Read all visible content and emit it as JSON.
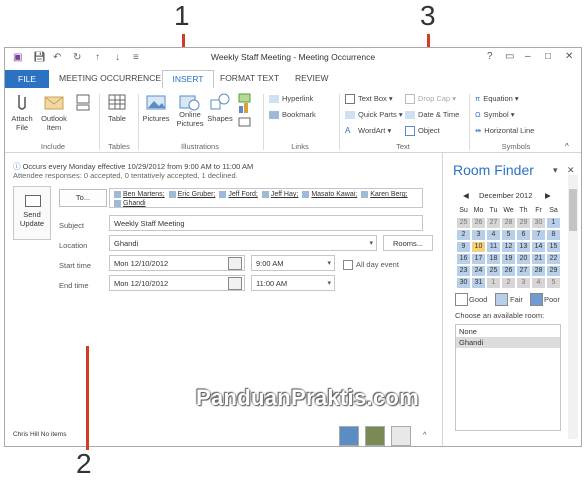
{
  "callouts": [
    "1",
    "3",
    "2"
  ],
  "window": {
    "title": "Weekly Staff Meeting - Meeting Occurrence",
    "controls": [
      "?",
      "▭",
      "–",
      "□",
      "✕"
    ]
  },
  "tabs": {
    "file": "FILE",
    "items": [
      "MEETING OCCURRENCE",
      "INSERT",
      "FORMAT TEXT",
      "REVIEW"
    ],
    "active": "INSERT"
  },
  "ribbon": {
    "include": {
      "attach_file": "Attach File",
      "outlook_item": "Outlook Item",
      "group": "Include"
    },
    "tables": {
      "table": "Table",
      "group": "Tables"
    },
    "illustrations": {
      "pictures": "Pictures",
      "online_pictures": "Online Pictures",
      "shapes": "Shapes",
      "group": "Illustrations"
    },
    "links": {
      "hyperlink": "Hyperlink",
      "bookmark": "Bookmark",
      "group": "Links"
    },
    "text": {
      "text_box": "Text Box",
      "quick_parts": "Quick Parts",
      "wordart": "WordArt",
      "drop_cap": "Drop Cap",
      "date_time": "Date & Time",
      "object": "Object",
      "group": "Text"
    },
    "symbols": {
      "equation": "Equation",
      "symbol": "Symbol",
      "horizontal_line": "Horizontal Line",
      "group": "Symbols"
    }
  },
  "info": {
    "line1": "Occurs every Monday effective 10/29/2012 from 9:00 AM to 11:00 AM",
    "line2": "Attendee responses: 0 accepted, 0 tentatively accepted, 1 declined."
  },
  "form": {
    "send_update": "Send Update",
    "to_button": "To...",
    "attendees": [
      "Ben Martens;",
      "Eric Gruber;",
      "Jeff Ford;",
      "Jeff Hay;",
      "Masato Kawai;",
      "Karen Berg;",
      "Ghandi"
    ],
    "subject_label": "Subject",
    "subject_value": "Weekly Staff Meeting",
    "location_label": "Location",
    "location_value": "Ghandi",
    "rooms_button": "Rooms...",
    "start_label": "Start time",
    "start_date": "Mon 12/10/2012",
    "start_time": "9:00 AM",
    "all_day": "All day event",
    "end_label": "End time",
    "end_date": "Mon 12/10/2012",
    "end_time": "11:00 AM"
  },
  "status": {
    "name": "Chris Hill  No items"
  },
  "room_finder": {
    "title": "Room Finder",
    "month": "December 2012",
    "days": [
      "Su",
      "Mo",
      "Tu",
      "We",
      "Th",
      "Fr",
      "Sa"
    ],
    "weeks": [
      [
        "25",
        "26",
        "27",
        "28",
        "29",
        "30",
        "1"
      ],
      [
        "2",
        "3",
        "4",
        "5",
        "6",
        "7",
        "8"
      ],
      [
        "9",
        "10",
        "11",
        "12",
        "13",
        "14",
        "15"
      ],
      [
        "16",
        "17",
        "18",
        "19",
        "20",
        "21",
        "22"
      ],
      [
        "23",
        "24",
        "25",
        "26",
        "27",
        "28",
        "29"
      ],
      [
        "30",
        "31",
        "1",
        "2",
        "3",
        "4",
        "5"
      ]
    ],
    "legend": {
      "good": "Good",
      "fair": "Fair",
      "poor": "Poor"
    },
    "choose_label": "Choose an available room:",
    "rooms": [
      "None",
      "Ghandi"
    ],
    "selected_room": "Ghandi"
  },
  "watermark": "PanduanPraktis.com",
  "colors": {
    "accent": "#2b72c2",
    "callout_line": "#d23c27",
    "fair": "#b7cfe9",
    "poor": "#6f9bd4",
    "good": "#ffffff",
    "today": "#f3d27a"
  }
}
